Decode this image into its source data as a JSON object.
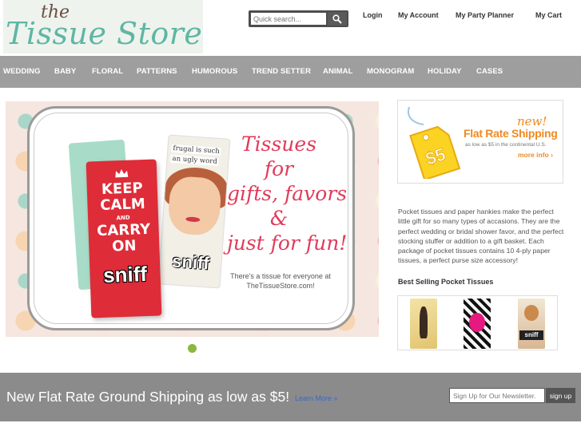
{
  "header": {
    "logo_line1": "the",
    "logo_line2": "Tissue Store",
    "search_placeholder": "Quick search...",
    "links": [
      "Login",
      "My Account",
      "My Party Planner",
      "My Cart"
    ]
  },
  "nav": {
    "items": [
      "WEDDING",
      "BABY",
      "FLORAL",
      "PATTERNS",
      "HUMOROUS",
      "TREND SETTER",
      "ANIMAL",
      "MONOGRAM",
      "HOLIDAY",
      "CASES"
    ]
  },
  "hero": {
    "pack_caption_line1": "frugal is such",
    "pack_caption_line2": "an ugly word",
    "pack_brand": "sniff",
    "keep": "KEEP",
    "calm": "CALM",
    "and": "AND",
    "carry": "CARRY",
    "on": "ON",
    "tagline": [
      "Tissues",
      "for",
      "gifts, favors",
      "&",
      "just for fun!"
    ],
    "subline": "There's a tissue for everyone at TheTissueStore.com!"
  },
  "promo": {
    "tag_price": "$5",
    "new_label": "new!",
    "title": "Flat Rate Shipping",
    "subtitle": "as low as $5 in the continental U.S.",
    "more": "more info ›"
  },
  "description": "Pocket tissues and paper hankies make the perfect little gift for so many types of accasions. They are the perfect wedding or bridal shower favor, and the perfect stocking stuffer or addition to a gift basket. Each package of pocket tissues contains 10 4-ply paper tissues, a perfect purse size accessory!",
  "best_selling_title": "Best Selling Pocket Tissues",
  "banner": {
    "text": "New Flat Rate Ground Shipping as low as $5!",
    "link": "Learn More »",
    "newsletter_placeholder": "Sign Up for Our Newsletter.",
    "signup": "sign up"
  },
  "colors": {
    "nav_bg": "#9e9e9e",
    "accent_orange": "#ef8a21",
    "logo_teal": "#5fb6a3",
    "tagline_pink": "#e13b5a",
    "slider_dot": "#8ab83f"
  }
}
